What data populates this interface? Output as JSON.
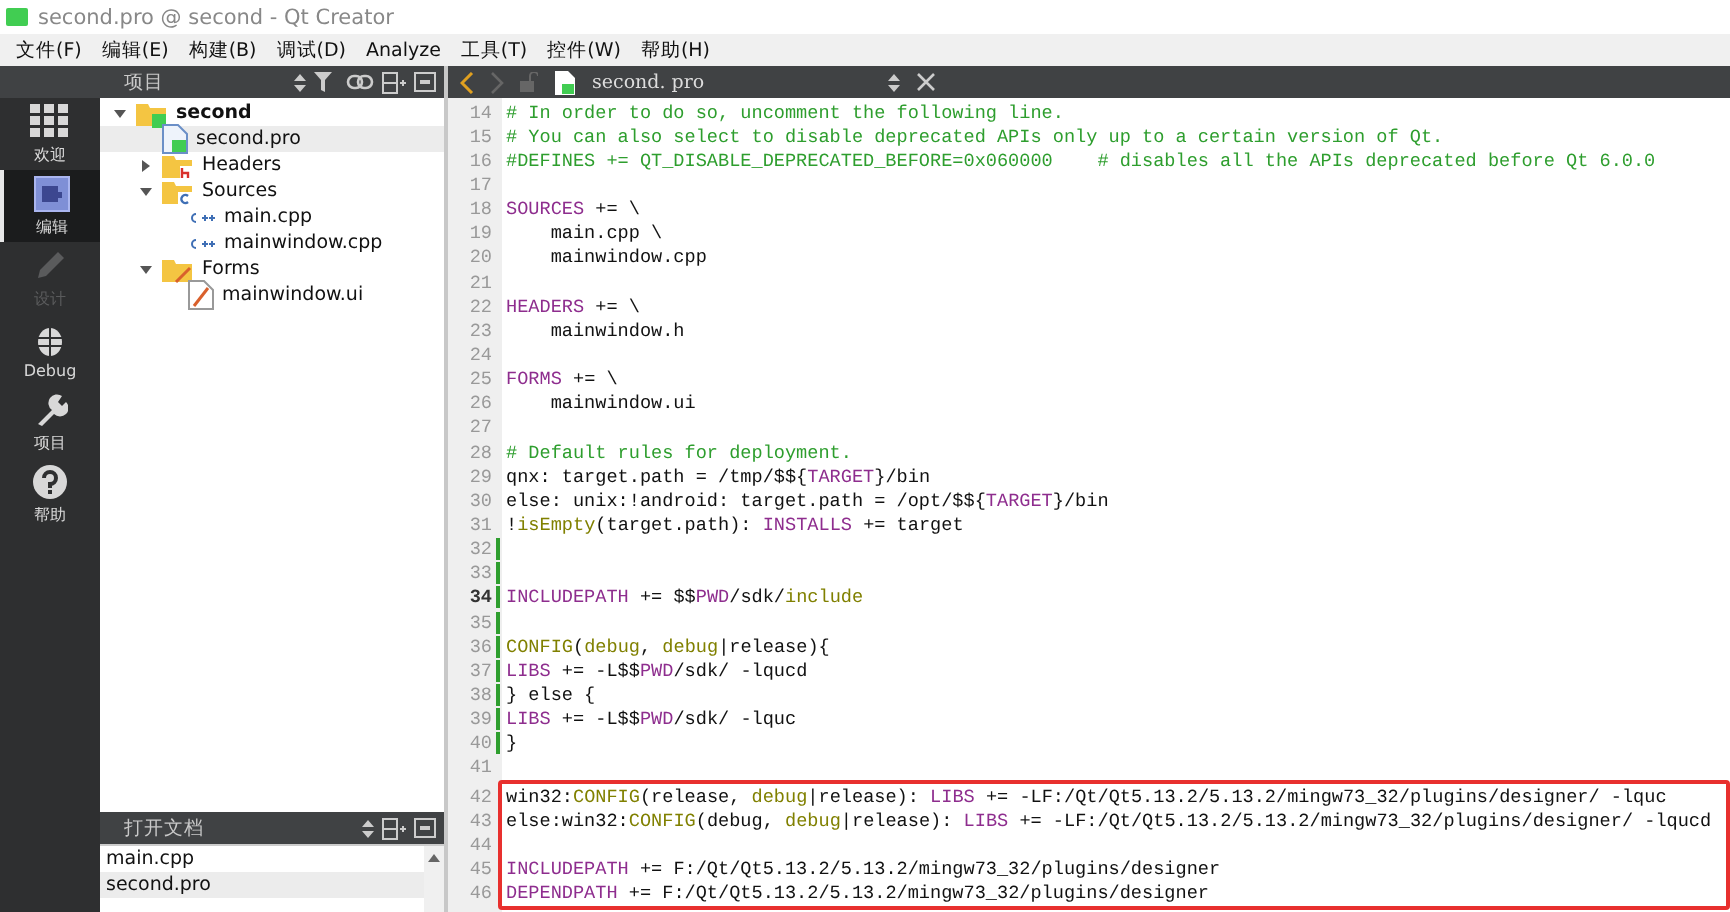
{
  "window": {
    "title": "second.pro @ second - Qt Creator"
  },
  "menu": [
    "文件(F)",
    "编辑(E)",
    "构建(B)",
    "调试(D)",
    "Analyze",
    "工具(T)",
    "控件(W)",
    "帮助(H)"
  ],
  "modes": [
    {
      "label": "欢迎",
      "selected": false,
      "disabled": false
    },
    {
      "label": "编辑",
      "selected": true,
      "disabled": false
    },
    {
      "label": "设计",
      "selected": false,
      "disabled": true
    },
    {
      "label": "Debug",
      "selected": false,
      "disabled": false
    },
    {
      "label": "项目",
      "selected": false,
      "disabled": false
    },
    {
      "label": "帮助",
      "selected": false,
      "disabled": false
    }
  ],
  "project_panel": {
    "title": "项目",
    "tree": [
      {
        "label": "second",
        "kind": "project",
        "expanded": true,
        "selected": false,
        "children": [
          {
            "label": "second.pro",
            "kind": "pro",
            "selected": true
          },
          {
            "label": "Headers",
            "kind": "headers",
            "expanded": false,
            "selected": false
          },
          {
            "label": "Sources",
            "kind": "sources",
            "expanded": true,
            "selected": false,
            "children": [
              {
                "label": "main.cpp",
                "kind": "cpp",
                "selected": false
              },
              {
                "label": "mainwindow.cpp",
                "kind": "cpp",
                "selected": false
              }
            ]
          },
          {
            "label": "Forms",
            "kind": "forms",
            "expanded": true,
            "selected": false,
            "children": [
              {
                "label": "mainwindow.ui",
                "kind": "ui",
                "selected": false
              }
            ]
          }
        ]
      }
    ]
  },
  "open_documents": {
    "title": "打开文档",
    "items": [
      {
        "label": "main.cpp",
        "selected": false
      },
      {
        "label": "second.pro",
        "selected": true
      }
    ]
  },
  "editor": {
    "file": "second. pro",
    "blocks": [
      {
        "boxed": false,
        "lines": [
          {
            "number": "14",
            "current": false,
            "modified": false,
            "segments": [
              {
                "kind": "comment",
                "text": "# In order to do so, uncomment the following line."
              }
            ]
          },
          {
            "number": "15",
            "current": false,
            "modified": false,
            "segments": [
              {
                "kind": "comment",
                "text": "# You can also select to disable deprecated APIs only up to a certain version of Qt."
              }
            ]
          },
          {
            "number": "16",
            "current": false,
            "modified": false,
            "segments": [
              {
                "kind": "comment",
                "text": "#DEFINES += QT_DISABLE_DEPRECATED_BEFORE=0x060000    # disables all the APIs deprecated before Qt 6.0.0"
              }
            ]
          },
          {
            "number": "17",
            "current": false,
            "modified": false
          },
          {
            "number": "18",
            "current": false,
            "modified": false,
            "segments": [
              {
                "kind": "keyword",
                "text": "SOURCES"
              },
              {
                "kind": "plain",
                "text": " += \\"
              }
            ]
          },
          {
            "number": "19",
            "current": false,
            "modified": false,
            "segments": [
              {
                "kind": "plain",
                "text": "    main.cpp \\"
              }
            ]
          },
          {
            "number": "20",
            "current": false,
            "modified": false,
            "segments": [
              {
                "kind": "plain",
                "text": "    mainwindow.cpp"
              }
            ]
          },
          {
            "number": "21",
            "current": false,
            "modified": false
          },
          {
            "number": "22",
            "current": false,
            "modified": false,
            "segments": [
              {
                "kind": "keyword",
                "text": "HEADERS"
              },
              {
                "kind": "plain",
                "text": " += \\"
              }
            ]
          },
          {
            "number": "23",
            "current": false,
            "modified": false,
            "segments": [
              {
                "kind": "plain",
                "text": "    mainwindow.h"
              }
            ]
          },
          {
            "number": "24",
            "current": false,
            "modified": false
          },
          {
            "number": "25",
            "current": false,
            "modified": false,
            "segments": [
              {
                "kind": "keyword",
                "text": "FORMS"
              },
              {
                "kind": "plain",
                "text": " += \\"
              }
            ]
          },
          {
            "number": "26",
            "current": false,
            "modified": false,
            "segments": [
              {
                "kind": "plain",
                "text": "    mainwindow.ui"
              }
            ]
          },
          {
            "number": "27",
            "current": false,
            "modified": false
          },
          {
            "number": "28",
            "current": false,
            "modified": false,
            "segments": [
              {
                "kind": "comment",
                "text": "# Default rules for deployment."
              }
            ]
          },
          {
            "number": "29",
            "current": false,
            "modified": false,
            "segments": [
              {
                "kind": "plain",
                "text": "qnx: target.path = /tmp/$${"
              },
              {
                "kind": "keyword",
                "text": "TARGET"
              },
              {
                "kind": "plain",
                "text": "}/bin"
              }
            ]
          },
          {
            "number": "30",
            "current": false,
            "modified": false,
            "segments": [
              {
                "kind": "plain",
                "text": "else: unix:!android: target.path = /opt/$${"
              },
              {
                "kind": "keyword",
                "text": "TARGET"
              },
              {
                "kind": "plain",
                "text": "}/bin"
              }
            ]
          },
          {
            "number": "31",
            "current": false,
            "modified": false,
            "segments": [
              {
                "kind": "plain",
                "text": "!"
              },
              {
                "kind": "function",
                "text": "isEmpty"
              },
              {
                "kind": "plain",
                "text": "(target.path): "
              },
              {
                "kind": "keyword",
                "text": "INSTALLS"
              },
              {
                "kind": "plain",
                "text": " += target"
              }
            ]
          },
          {
            "number": "32",
            "current": false,
            "modified": true
          },
          {
            "number": "33",
            "current": false,
            "modified": true
          },
          {
            "number": "34",
            "current": true,
            "modified": true,
            "segments": [
              {
                "kind": "keyword",
                "text": "INCLUDEPATH"
              },
              {
                "kind": "plain",
                "text": " += $$"
              },
              {
                "kind": "keyword",
                "text": "PWD"
              },
              {
                "kind": "plain",
                "text": "/sdk/"
              },
              {
                "kind": "function",
                "text": "include"
              }
            ]
          },
          {
            "number": "35",
            "current": false,
            "modified": true
          },
          {
            "number": "36",
            "current": false,
            "modified": true,
            "segments": [
              {
                "kind": "function",
                "text": "CONFIG"
              },
              {
                "kind": "plain",
                "text": "("
              },
              {
                "kind": "function",
                "text": "debug"
              },
              {
                "kind": "plain",
                "text": ", "
              },
              {
                "kind": "function",
                "text": "debug"
              },
              {
                "kind": "plain",
                "text": "|release){"
              }
            ]
          },
          {
            "number": "37",
            "current": false,
            "modified": true,
            "segments": [
              {
                "kind": "keyword",
                "text": "LIBS"
              },
              {
                "kind": "plain",
                "text": " += -L$$"
              },
              {
                "kind": "keyword",
                "text": "PWD"
              },
              {
                "kind": "plain",
                "text": "/sdk/ -lqucd"
              }
            ]
          },
          {
            "number": "38",
            "current": false,
            "modified": true,
            "segments": [
              {
                "kind": "plain",
                "text": "} else {"
              }
            ]
          },
          {
            "number": "39",
            "current": false,
            "modified": true,
            "segments": [
              {
                "kind": "keyword",
                "text": "LIBS"
              },
              {
                "kind": "plain",
                "text": " += -L$$"
              },
              {
                "kind": "keyword",
                "text": "PWD"
              },
              {
                "kind": "plain",
                "text": "/sdk/ -lquc"
              }
            ]
          },
          {
            "number": "40",
            "current": false,
            "modified": true,
            "segments": [
              {
                "kind": "plain",
                "text": "}"
              }
            ]
          },
          {
            "number": "41",
            "current": false,
            "modified": false
          }
        ]
      },
      {
        "boxed": true,
        "lines": [
          {
            "number": "42",
            "current": false,
            "modified": false,
            "segments": [
              {
                "kind": "plain",
                "text": "win32:"
              },
              {
                "kind": "function",
                "text": "CONFIG"
              },
              {
                "kind": "plain",
                "text": "(release, "
              },
              {
                "kind": "function",
                "text": "debug"
              },
              {
                "kind": "plain",
                "text": "|release): "
              },
              {
                "kind": "keyword",
                "text": "LIBS"
              },
              {
                "kind": "plain",
                "text": " += -LF:/Qt/Qt5.13.2/5.13.2/mingw73_32/plugins/designer/ -lquc"
              }
            ]
          },
          {
            "number": "43",
            "current": false,
            "modified": false,
            "segments": [
              {
                "kind": "plain",
                "text": "else:win32:"
              },
              {
                "kind": "function",
                "text": "CONFIG"
              },
              {
                "kind": "plain",
                "text": "(debug, "
              },
              {
                "kind": "function",
                "text": "debug"
              },
              {
                "kind": "plain",
                "text": "|release): "
              },
              {
                "kind": "keyword",
                "text": "LIBS"
              },
              {
                "kind": "plain",
                "text": " += -LF:/Qt/Qt5.13.2/5.13.2/mingw73_32/plugins/designer/ -lqucd"
              }
            ]
          },
          {
            "number": "44",
            "current": false,
            "modified": false
          },
          {
            "number": "45",
            "current": false,
            "modified": false,
            "segments": [
              {
                "kind": "keyword",
                "text": "INCLUDEPATH"
              },
              {
                "kind": "plain",
                "text": " += F:/Qt/Qt5.13.2/5.13.2/mingw73_32/plugins/designer"
              }
            ]
          },
          {
            "number": "46",
            "current": false,
            "modified": false,
            "segments": [
              {
                "kind": "keyword",
                "text": "DEPENDPATH"
              },
              {
                "kind": "plain",
                "text": " += F:/Qt/Qt5.13.2/5.13.2/mingw73_32/plugins/designer"
              }
            ]
          }
        ]
      }
    ]
  }
}
